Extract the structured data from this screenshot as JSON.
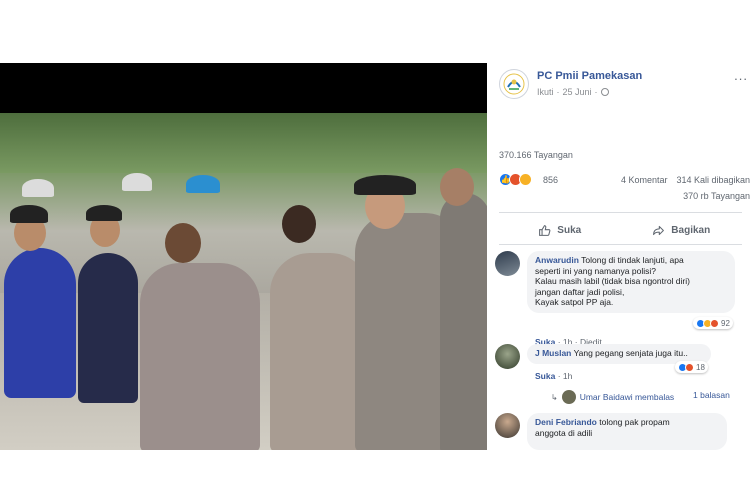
{
  "page": {
    "name": "PC Pmii Pamekasan",
    "follow": "Ikuti",
    "date": "25 Juni",
    "more": "..."
  },
  "stats": {
    "views": "370.166 Tayangan",
    "reactions": "856",
    "comments": "4 Komentar",
    "shares": "314 Kali dibagikan",
    "plays": "370 rb Tayangan"
  },
  "actions": {
    "like": "Suka",
    "share": "Bagikan"
  },
  "comments": [
    {
      "author": "Anwarudin",
      "text_line1": "Tolong di tindak lanjuti, apa",
      "text_line2": "seperti ini yang namanya polisi?",
      "text_line3": "Kalau masih labil (tidak bisa ngontrol diri)",
      "text_line4": "jangan daftar jadi polisi,",
      "text_line5": "Kayak satpol PP aja.",
      "like": "Suka",
      "time": "1h",
      "edited": "Diedit",
      "reaction_count": "92"
    },
    {
      "author": "J Muslan",
      "text": "Yang pegang senjata juga itu..",
      "like": "Suka",
      "time": "1h",
      "reaction_count": "18",
      "reply_author": "Umar Baidawi membalas",
      "reply_count": "1 balasan"
    },
    {
      "author": "Deni Febriando",
      "text_line1": "tolong pak propam",
      "text_line2": "anggota di adili"
    }
  ],
  "colors": {
    "link": "#385898",
    "like_blue": "#1877f2",
    "angry": "#e4522b",
    "wow": "#f7b125",
    "bubble": "#f2f3f5"
  },
  "icons": {
    "more": "more-icon",
    "globe": "globe-icon",
    "like": "thumbs-up-icon",
    "share": "share-arrow-icon"
  }
}
